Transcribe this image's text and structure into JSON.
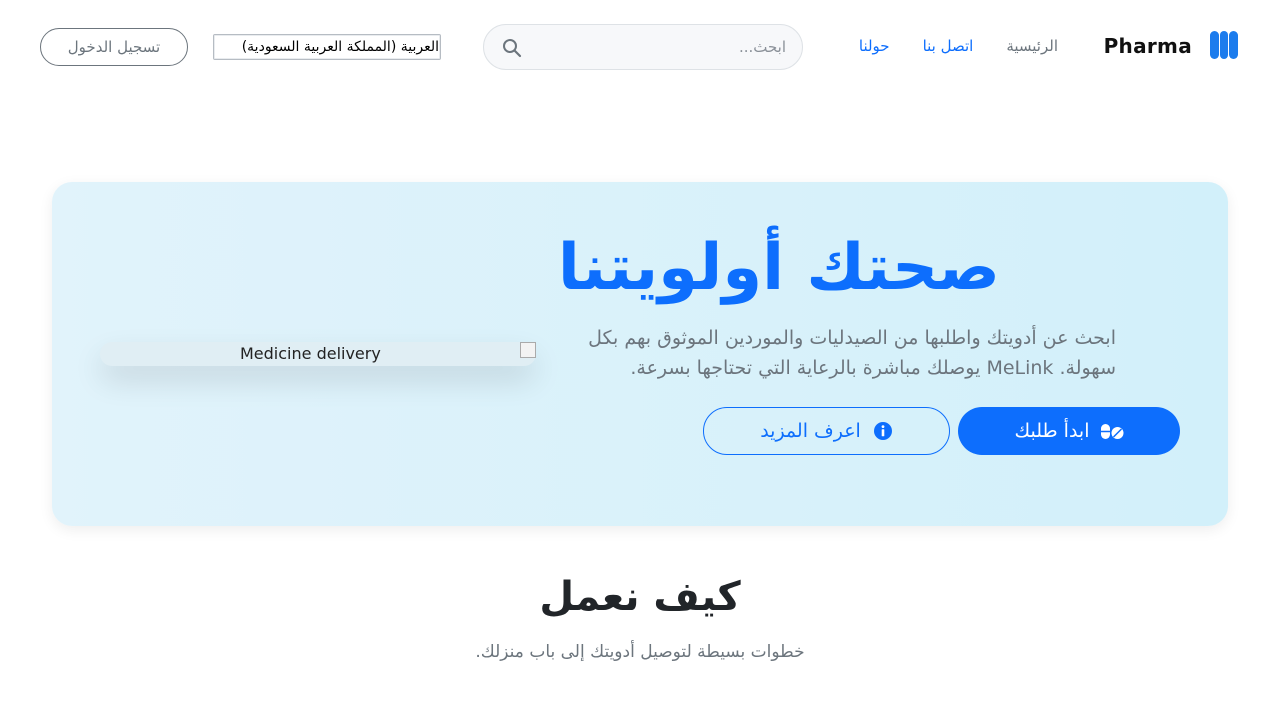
{
  "header": {
    "brand": "Pharma",
    "nav": {
      "home": "الرئيسية",
      "contact": "اتصل بنا",
      "about": "حولنا"
    },
    "search": {
      "placeholder": "ابحث..."
    },
    "language": "العربية (المملكة العربية السعودية)",
    "login": "تسجيل الدخول"
  },
  "hero": {
    "title": "صحتك أولويتنا",
    "description": "ابحث عن أدويتك واطلبها من الصيدليات والموردين الموثوق بهم بكل سهولة. MeLink يوصلك مباشرة بالرعاية التي تحتاجها بسرعة.",
    "primary_button": "ابدأ طلبك",
    "secondary_button": "اعرف المزيد",
    "image_alt": "Medicine delivery"
  },
  "how_it_works": {
    "title": "كيف نعمل",
    "subtitle": "خطوات بسيطة لتوصيل أدويتك إلى باب منزلك."
  },
  "colors": {
    "primary": "#0d6efd",
    "muted": "#6c757d",
    "hero_bg": "#d8f2fb"
  }
}
